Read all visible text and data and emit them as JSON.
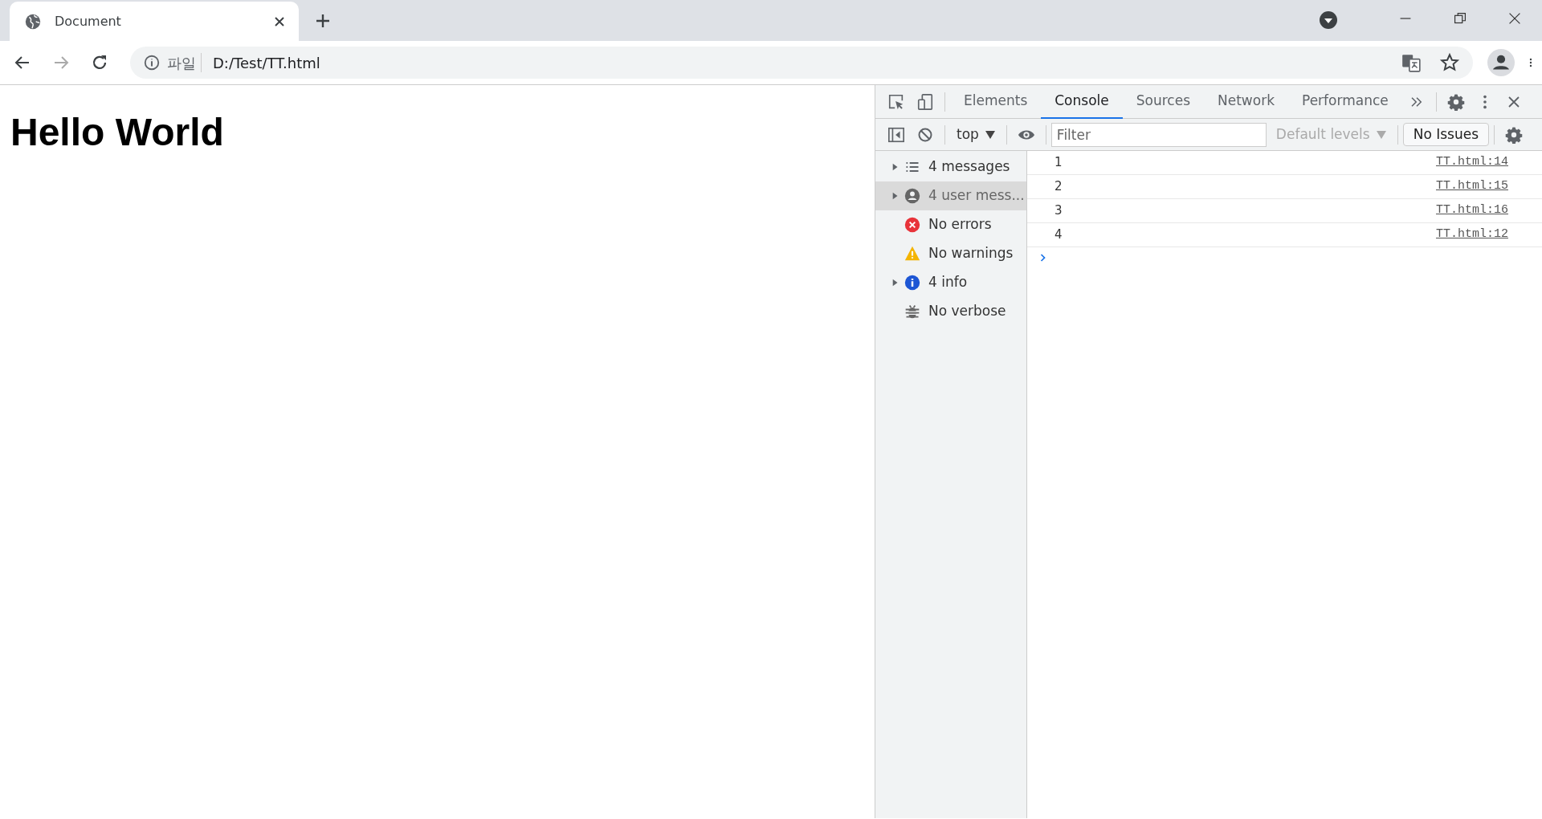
{
  "browser": {
    "tabs": [
      {
        "title": "Document",
        "selected": true
      }
    ],
    "address": {
      "scheme_label": "파일",
      "url": "D:/Test/TT.html"
    }
  },
  "page": {
    "heading": "Hello World"
  },
  "devtools": {
    "tabs": [
      {
        "label": "Elements",
        "selected": false
      },
      {
        "label": "Console",
        "selected": true
      },
      {
        "label": "Sources",
        "selected": false
      },
      {
        "label": "Network",
        "selected": false
      },
      {
        "label": "Performance",
        "selected": false
      }
    ],
    "context": "top",
    "filter": {
      "placeholder": "Filter"
    },
    "levels": "Default levels",
    "issues": "No Issues",
    "sidebar": [
      {
        "kind": "list",
        "label": "4 messages",
        "expandable": true,
        "selected": false
      },
      {
        "kind": "user",
        "label": "4 user mess...",
        "expandable": true,
        "selected": true
      },
      {
        "kind": "error",
        "label": "No errors",
        "expandable": false,
        "selected": false
      },
      {
        "kind": "warning",
        "label": "No warnings",
        "expandable": false,
        "selected": false
      },
      {
        "kind": "info",
        "label": "4 info",
        "expandable": true,
        "selected": false
      },
      {
        "kind": "verbose",
        "label": "No verbose",
        "expandable": false,
        "selected": false
      }
    ],
    "messages": [
      {
        "text": "1",
        "source": "TT.html:14"
      },
      {
        "text": "2",
        "source": "TT.html:15"
      },
      {
        "text": "3",
        "source": "TT.html:16"
      },
      {
        "text": "4",
        "source": "TT.html:12"
      }
    ]
  }
}
